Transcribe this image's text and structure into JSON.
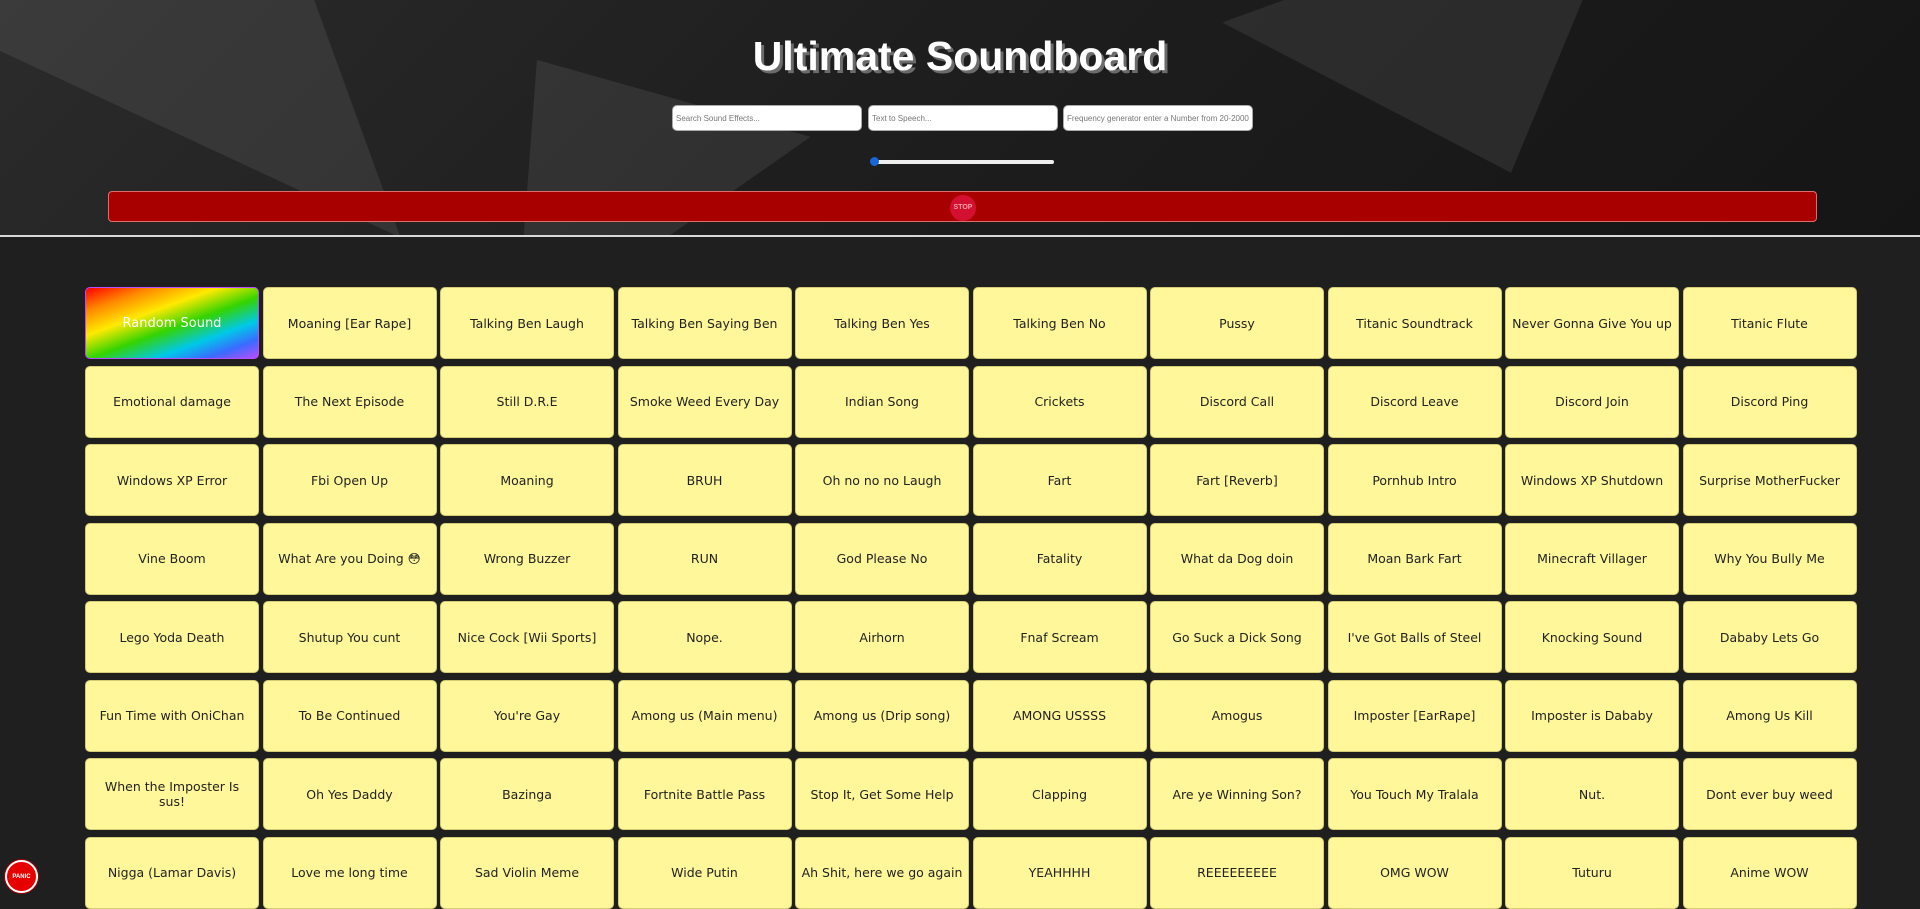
{
  "header": {
    "title": "Ultimate Soundboard"
  },
  "inputs": {
    "search_placeholder": "Search Sound Effects...",
    "tts_placeholder": "Text to Speech...",
    "frequency_placeholder": "Frequency generator enter a Number from 20-20000"
  },
  "volume": {
    "level": 0.0
  },
  "stop_button": {
    "label": "STOP",
    "color": "#a80000"
  },
  "panic_button": {
    "label": "PANIC",
    "color": "#e60000"
  },
  "colors": {
    "button_bg": "#fff799",
    "page_bg": "#1f1f1f"
  },
  "sounds": [
    "Random Sound",
    "Moaning [Ear Rape]",
    "Talking Ben Laugh",
    "Talking Ben Saying Ben",
    "Talking Ben Yes",
    "Talking Ben No",
    "Pussy",
    "Titanic Soundtrack",
    "Never Gonna Give You up",
    "Titanic Flute",
    "Emotional damage",
    "The Next Episode",
    "Still D.R.E",
    "Smoke Weed Every Day",
    "Indian Song",
    "Crickets",
    "Discord Call",
    "Discord Leave",
    "Discord Join",
    "Discord Ping",
    "Windows XP Error",
    "Fbi Open Up",
    "Moaning",
    "BRUH",
    "Oh no no no Laugh",
    "Fart",
    "Fart [Reverb]",
    "Pornhub Intro",
    "Windows XP Shutdown",
    "Surprise MotherFucker",
    "Vine Boom",
    "What Are you Doing 😳",
    "Wrong Buzzer",
    "RUN",
    "God Please No",
    "Fatality",
    "What da Dog doin",
    "Moan Bark Fart",
    "Minecraft Villager",
    "Why You Bully Me",
    "Lego Yoda Death",
    "Shutup You cunt",
    "Nice Cock [Wii Sports]",
    "Nope.",
    "Airhorn",
    "Fnaf Scream",
    "Go Suck a Dick Song",
    "I've Got Balls of Steel",
    "Knocking Sound",
    "Dababy Lets Go",
    "Fun Time with OniChan",
    "To Be Continued",
    "You're Gay",
    "Among us (Main menu)",
    "Among us (Drip song)",
    "AMONG USSSS",
    "Amogus",
    "Imposter [EarRape]",
    "Imposter is Dababy",
    "Among Us Kill",
    "When the Imposter Is sus!",
    "Oh Yes Daddy",
    "Bazinga",
    "Fortnite Battle Pass",
    "Stop It, Get Some Help",
    "Clapping",
    "Are ye Winning Son?",
    "You Touch My Tralala",
    "Nut.",
    "Dont ever buy weed",
    "Nigga (Lamar Davis)",
    "Love me long time",
    "Sad Violin Meme",
    "Wide Putin",
    "Ah Shit, here we go again",
    "YEAHHHH",
    "REEEEEEEEE",
    "OMG WOW",
    "Tuturu",
    "Anime WOW"
  ]
}
